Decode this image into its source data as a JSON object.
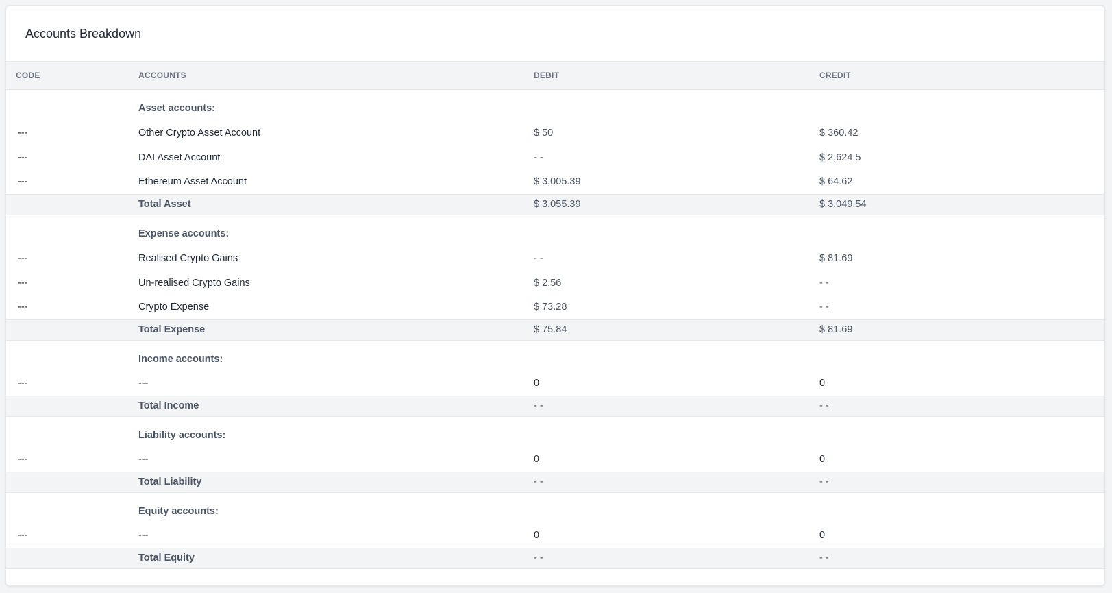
{
  "card": {
    "title": "Accounts Breakdown"
  },
  "table": {
    "headers": {
      "code": "CODE",
      "accounts": "ACCOUNTS",
      "debit": "DEBIT",
      "credit": "CREDIT"
    },
    "groups": [
      {
        "label": "Asset accounts:",
        "rows": [
          {
            "code": "---",
            "account": "Other Crypto Asset Account",
            "debit": "$ 50",
            "credit": "$ 360.42"
          },
          {
            "code": "---",
            "account": "DAI Asset Account",
            "debit": "- -",
            "credit": "$ 2,624.5"
          },
          {
            "code": "---",
            "account": "Ethereum Asset Account",
            "debit": "$ 3,005.39",
            "credit": "$ 64.62"
          }
        ],
        "total": {
          "label": "Total Asset",
          "debit": "$ 3,055.39",
          "credit": "$ 3,049.54"
        }
      },
      {
        "label": "Expense accounts:",
        "rows": [
          {
            "code": "---",
            "account": "Realised Crypto Gains",
            "debit": "- -",
            "credit": "$ 81.69"
          },
          {
            "code": "---",
            "account": "Un-realised Crypto Gains",
            "debit": "$ 2.56",
            "credit": "- -"
          },
          {
            "code": "---",
            "account": "Crypto Expense",
            "debit": "$ 73.28",
            "credit": "- -"
          }
        ],
        "total": {
          "label": "Total Expense",
          "debit": "$ 75.84",
          "credit": "$ 81.69"
        }
      },
      {
        "label": "Income accounts:",
        "rows": [
          {
            "code": "---",
            "account": "---",
            "debit": "0",
            "credit": "0"
          }
        ],
        "total": {
          "label": "Total Income",
          "debit": "- -",
          "credit": "- -"
        }
      },
      {
        "label": "Liability accounts:",
        "rows": [
          {
            "code": "---",
            "account": "---",
            "debit": "0",
            "credit": "0"
          }
        ],
        "total": {
          "label": "Total Liability",
          "debit": "- -",
          "credit": "- -"
        }
      },
      {
        "label": "Equity accounts:",
        "rows": [
          {
            "code": "---",
            "account": "---",
            "debit": "0",
            "credit": "0"
          }
        ],
        "total": {
          "label": "Total Equity",
          "debit": "- -",
          "credit": "- -"
        }
      }
    ]
  }
}
